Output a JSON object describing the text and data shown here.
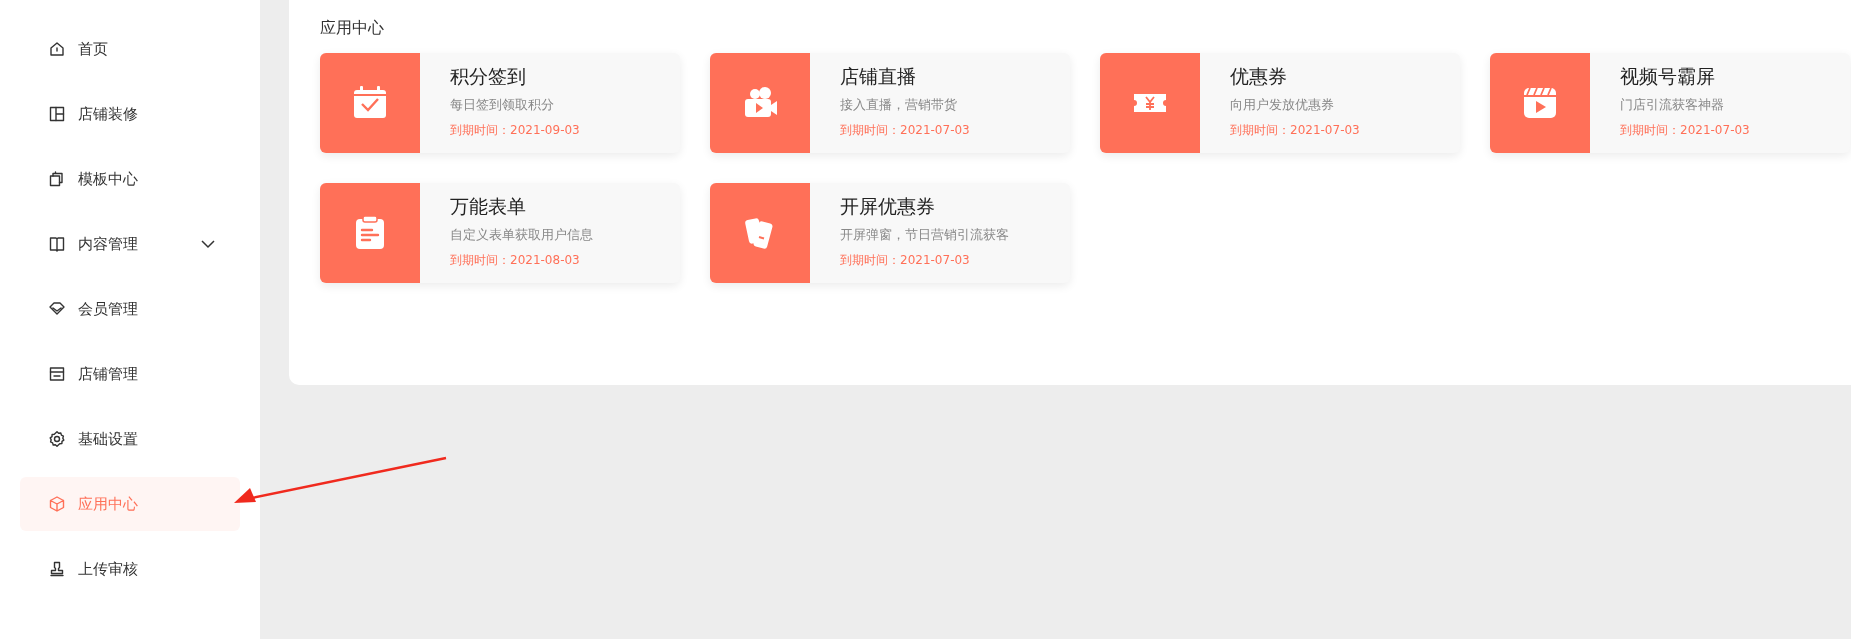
{
  "sidebar": {
    "items": [
      {
        "label": "首页",
        "selected": false,
        "kind": "link"
      },
      {
        "label": "店铺装修",
        "selected": false,
        "kind": "link"
      },
      {
        "label": "模板中心",
        "selected": false,
        "kind": "link"
      },
      {
        "label": "内容管理",
        "selected": false,
        "kind": "group",
        "expanded": false
      },
      {
        "label": "会员管理",
        "selected": false,
        "kind": "link"
      },
      {
        "label": "店铺管理",
        "selected": false,
        "kind": "link"
      },
      {
        "label": "基础设置",
        "selected": false,
        "kind": "link"
      },
      {
        "label": "应用中心",
        "selected": true,
        "kind": "link"
      },
      {
        "label": "上传审核",
        "selected": false,
        "kind": "link"
      }
    ]
  },
  "main": {
    "title": "应用中心",
    "apps": [
      {
        "name": "积分签到",
        "description": "每日签到领取积分",
        "expiry": "到期时间：2021-09-03"
      },
      {
        "name": "店铺直播",
        "description": "接入直播，营销带货",
        "expiry": "到期时间：2021-07-03"
      },
      {
        "name": "优惠券",
        "description": "向用户发放优惠券",
        "expiry": "到期时间：2021-07-03"
      },
      {
        "name": "视频号霸屏",
        "description": "门店引流获客神器",
        "expiry": "到期时间：2021-07-03"
      },
      {
        "name": "万能表单",
        "description": "自定义表单获取用户信息",
        "expiry": "到期时间：2021-08-03"
      },
      {
        "name": "开屏优惠券",
        "description": "开屏弹窗，节日营销引流获客",
        "expiry": "到期时间：2021-07-03"
      }
    ]
  }
}
